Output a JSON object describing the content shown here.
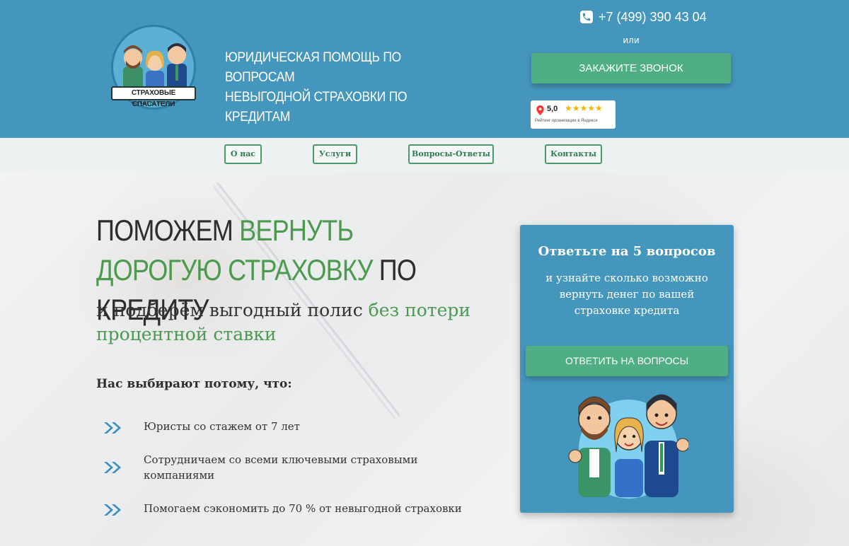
{
  "header": {
    "logo_text": "СТРАХОВЫЕ СПАСАТЕЛИ",
    "logo_tagline": "спешат на помощь",
    "title_line1": "ЮРИДИЧЕСКАЯ ПОМОЩЬ ПО ВОПРОСАМ",
    "title_line2": "НЕВЫГОДНОЙ СТРАХОВКИ ПО КРЕДИТАМ",
    "phone": "+7 (499) 390 43 04",
    "or": "или",
    "call_button": "ЗАКАЖИТЕ ЗВОНОК",
    "rating_score": "5,0",
    "rating_stars": "★★★★★",
    "rating_caption": "Рейтинг организации в Яндексе"
  },
  "nav": {
    "items": [
      "О нас",
      "Услуги",
      "Вопросы-Ответы",
      "Контакты"
    ]
  },
  "hero": {
    "title_part1": "ПОМОЖЕМ ",
    "title_part2": "ВЕРНУТЬ ДОРОГУЮ СТРАХОВКУ",
    "title_part3": " ПО КРЕДИТУ",
    "subtitle_part1": "и подберём выгодный полис ",
    "subtitle_part2": "без потери процентной ставки",
    "choose_heading": "Нас выбирают потому, что:",
    "benefits": [
      "Юристы со стажем от 7 лет",
      "Сотрудничаем со всеми ключевыми страховыми компаниями",
      "Помогаем сэкономить до 70 % от невыгодной страховки"
    ]
  },
  "quiz": {
    "title": "Ответьте на 5 вопросов",
    "subtitle": "и узнайте сколько возможно вернуть денег по вашей страховке кредита",
    "button": "ОТВЕТИТЬ НА ВОПРОСЫ"
  },
  "colors": {
    "primary_blue": "#4596bd",
    "accent_green": "#4fae83",
    "text_green": "#4b9a4f"
  }
}
